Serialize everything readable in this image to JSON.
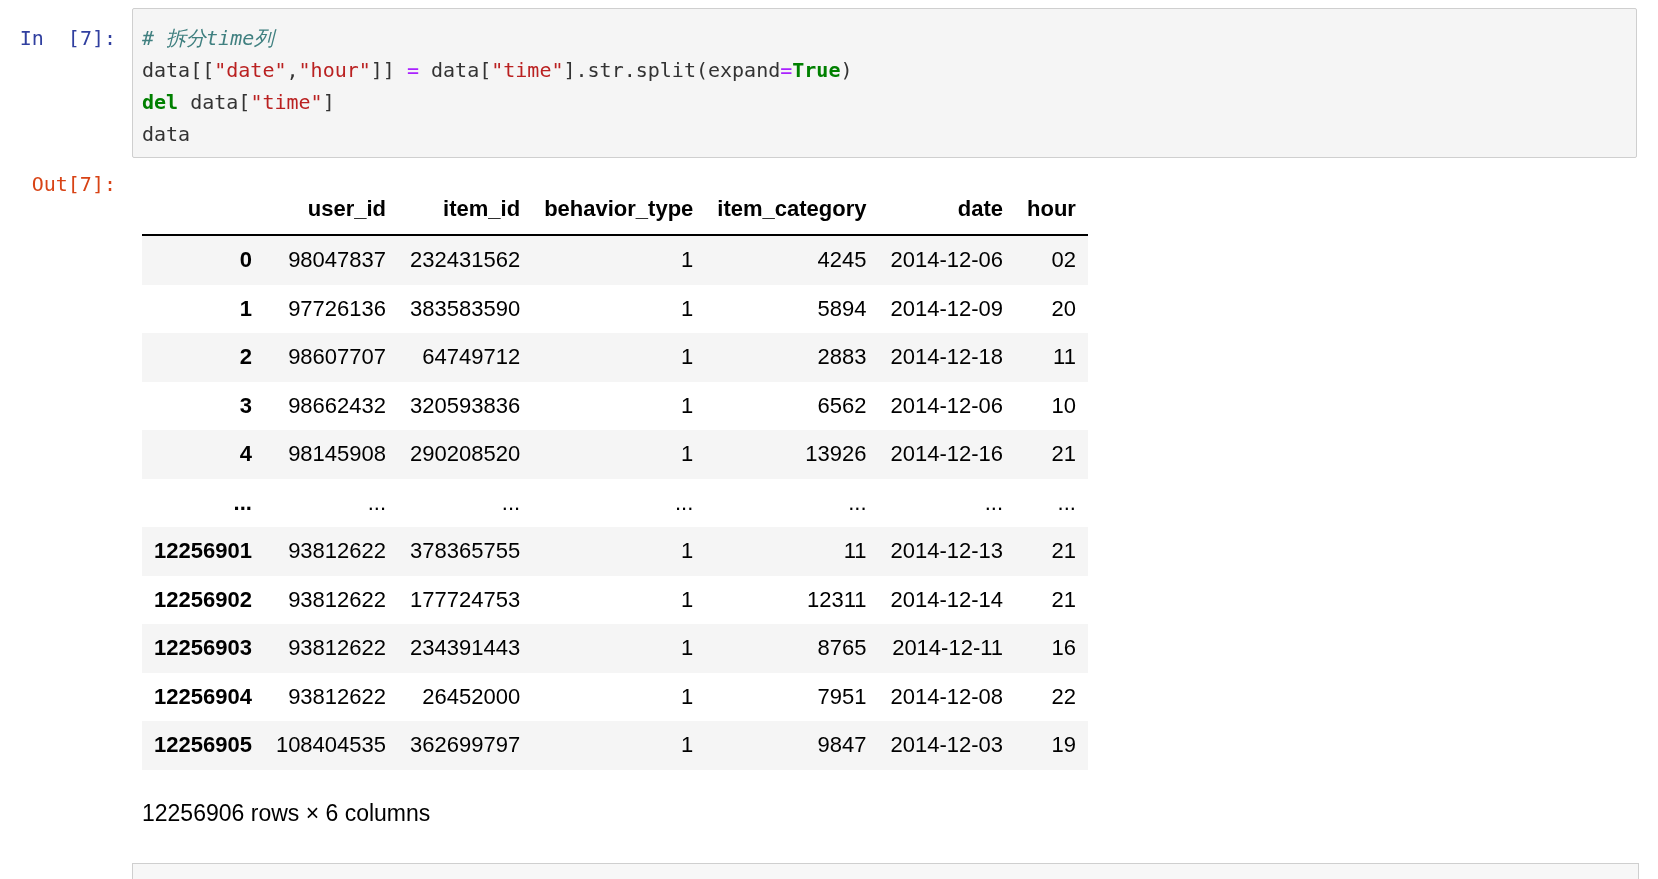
{
  "input_cell": {
    "prompt": "In  [7]:",
    "code_lines": [
      [
        {
          "kind": "comment",
          "text": "# 拆分time列"
        }
      ],
      [
        {
          "kind": "plain",
          "text": "data[["
        },
        {
          "kind": "string",
          "text": "\"date\""
        },
        {
          "kind": "plain",
          "text": ","
        },
        {
          "kind": "string",
          "text": "\"hour\""
        },
        {
          "kind": "plain",
          "text": "]] "
        },
        {
          "kind": "operator",
          "text": "="
        },
        {
          "kind": "plain",
          "text": " data["
        },
        {
          "kind": "string",
          "text": "\"time\""
        },
        {
          "kind": "plain",
          "text": "].str.split(expand"
        },
        {
          "kind": "operator",
          "text": "="
        },
        {
          "kind": "keyword",
          "text": "True"
        },
        {
          "kind": "plain",
          "text": ")"
        }
      ],
      [
        {
          "kind": "keyword",
          "text": "del"
        },
        {
          "kind": "plain",
          "text": " data["
        },
        {
          "kind": "string",
          "text": "\"time\""
        },
        {
          "kind": "plain",
          "text": "]"
        }
      ],
      [
        {
          "kind": "plain",
          "text": "data"
        }
      ]
    ]
  },
  "output_cell": {
    "prompt": "Out[7]:",
    "table": {
      "columns": [
        "",
        "user_id",
        "item_id",
        "behavior_type",
        "item_category",
        "date",
        "hour"
      ],
      "rows": [
        [
          "0",
          "98047837",
          "232431562",
          "1",
          "4245",
          "2014-12-06",
          "02"
        ],
        [
          "1",
          "97726136",
          "383583590",
          "1",
          "5894",
          "2014-12-09",
          "20"
        ],
        [
          "2",
          "98607707",
          "64749712",
          "1",
          "2883",
          "2014-12-18",
          "11"
        ],
        [
          "3",
          "98662432",
          "320593836",
          "1",
          "6562",
          "2014-12-06",
          "10"
        ],
        [
          "4",
          "98145908",
          "290208520",
          "1",
          "13926",
          "2014-12-16",
          "21"
        ],
        [
          "...",
          "...",
          "...",
          "...",
          "...",
          "...",
          "..."
        ],
        [
          "12256901",
          "93812622",
          "378365755",
          "1",
          "11",
          "2014-12-13",
          "21"
        ],
        [
          "12256902",
          "93812622",
          "177724753",
          "1",
          "12311",
          "2014-12-14",
          "21"
        ],
        [
          "12256903",
          "93812622",
          "234391443",
          "1",
          "8765",
          "2014-12-11",
          "16"
        ],
        [
          "12256904",
          "93812622",
          "26452000",
          "1",
          "7951",
          "2014-12-08",
          "22"
        ],
        [
          "12256905",
          "108404535",
          "362699797",
          "1",
          "9847",
          "2014-12-03",
          "19"
        ]
      ]
    },
    "summary": "12256906 rows × 6 columns"
  }
}
